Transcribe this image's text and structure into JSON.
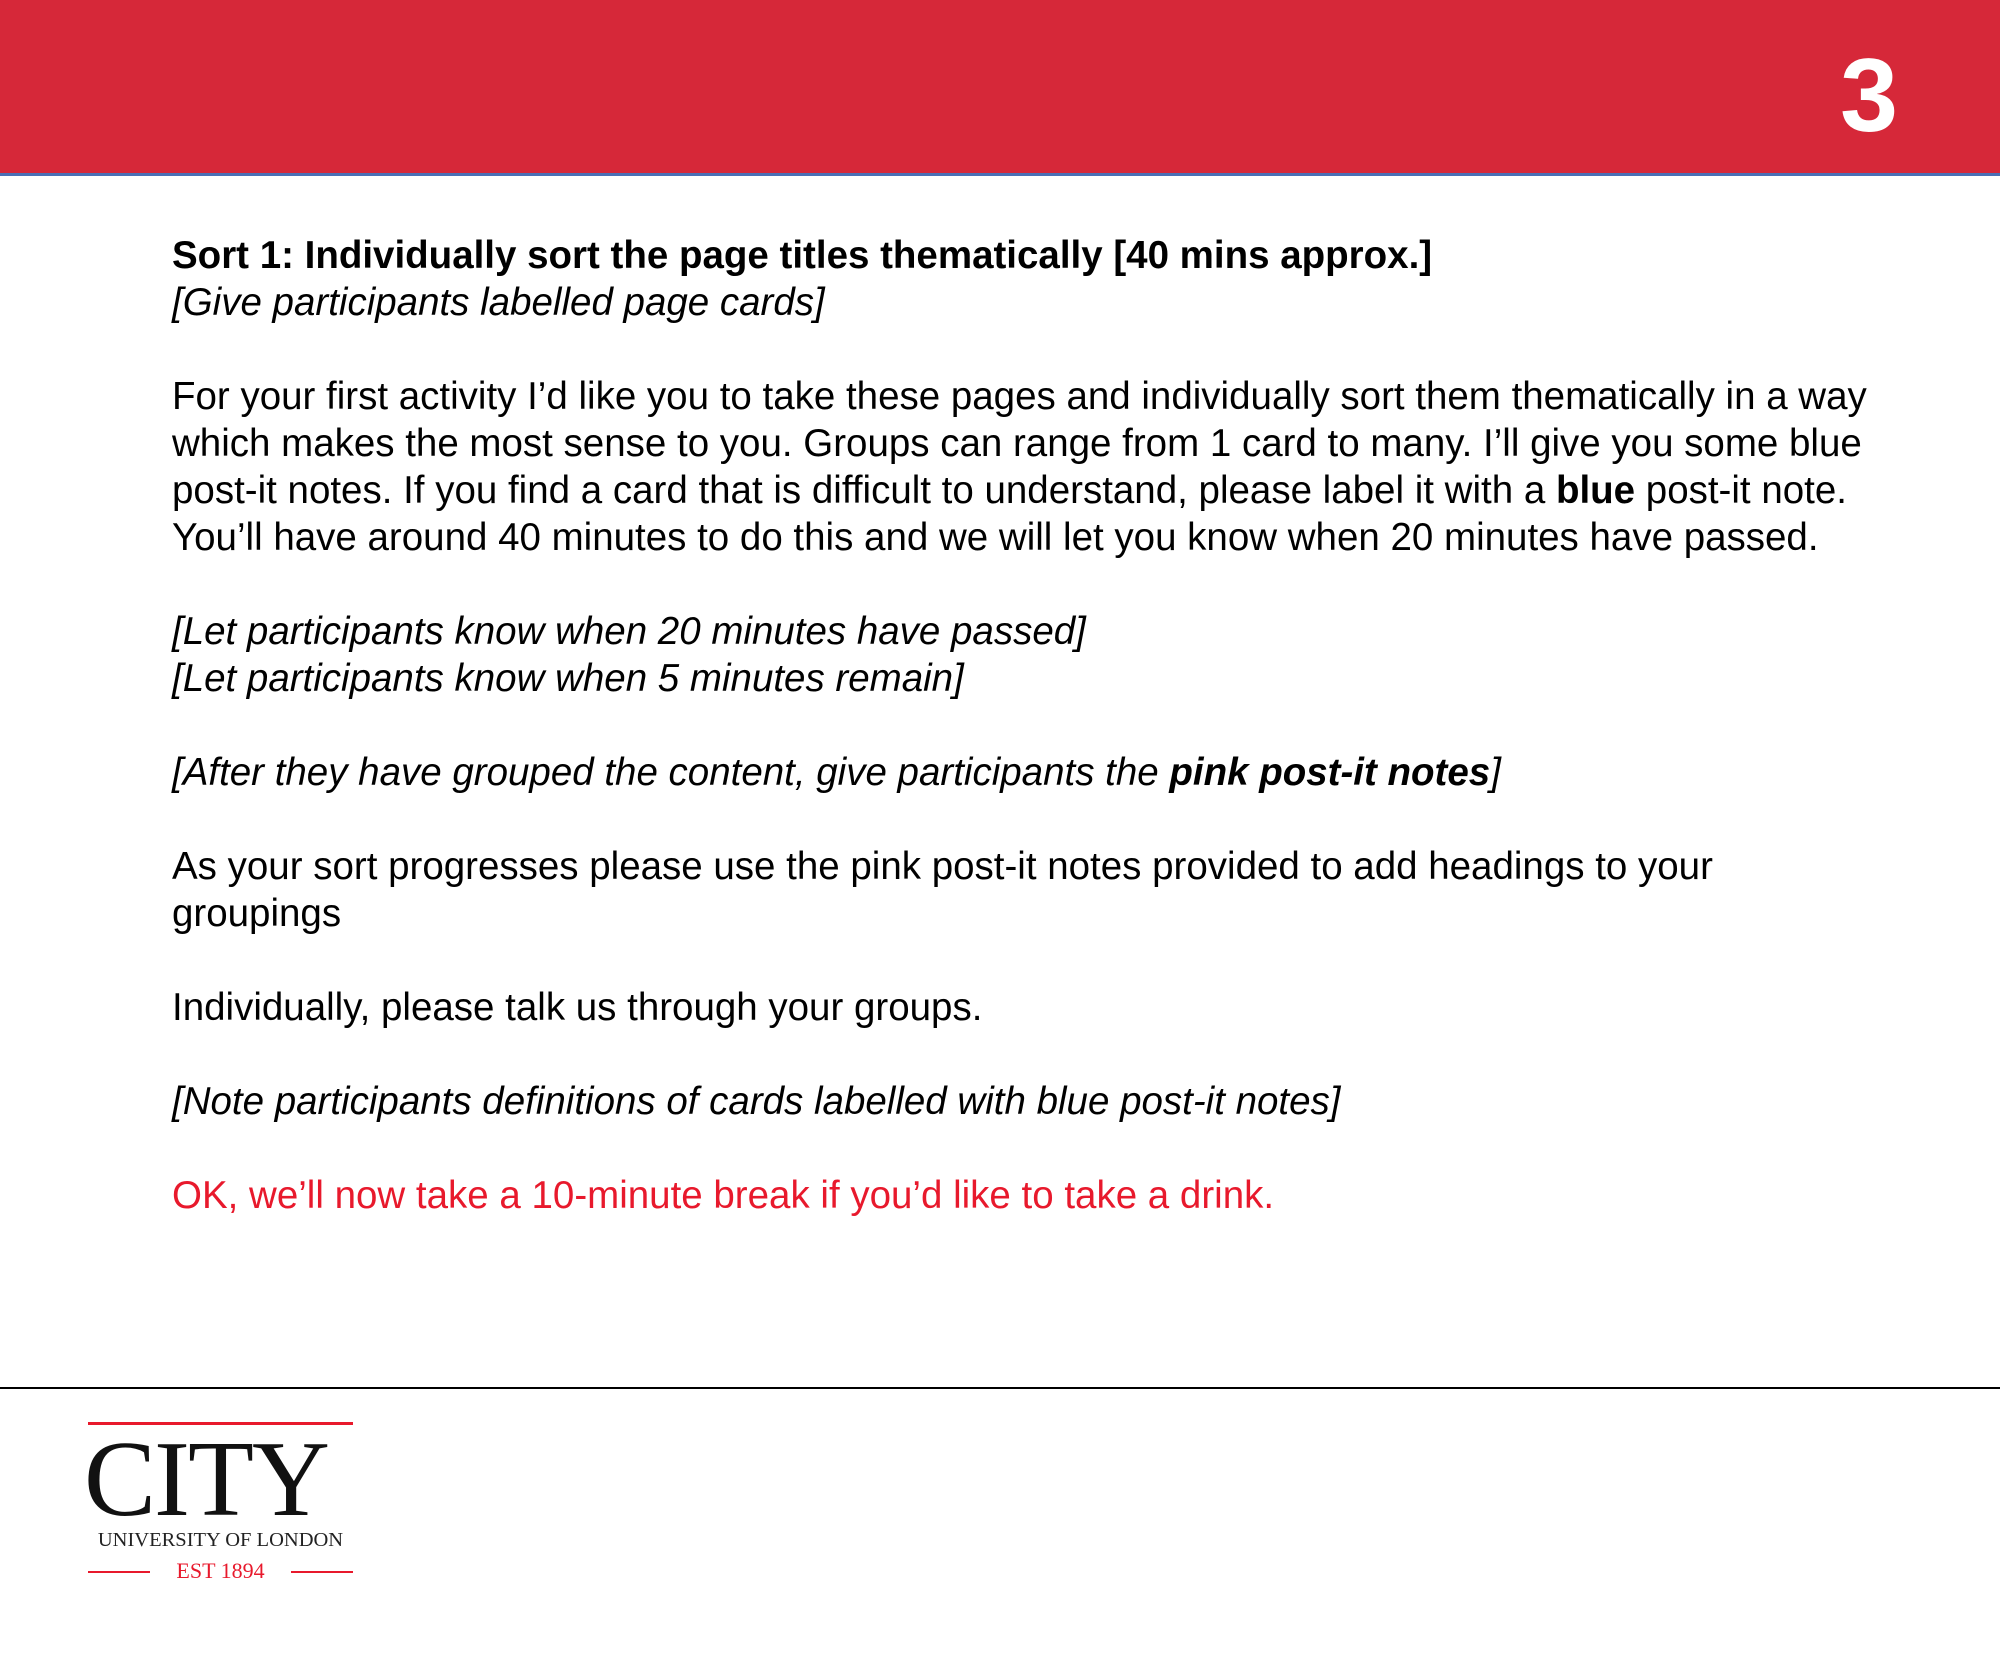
{
  "colors": {
    "header_red": "#d62839",
    "accent_red": "#e8192c",
    "header_underline_blue": "#4a6fb5"
  },
  "header": {
    "page_number": "3"
  },
  "content": {
    "heading": "Sort 1: Individually sort the page titles thematically [40 mins approx.]",
    "give_cards_instruction": "[Give participants labelled page cards]",
    "paragraph1": {
      "before_bold": "For your first activity I’d like you to take these pages and individually sort them thematically in a way which makes the most sense to you. Groups can range from 1 card to many. I’ll give you some blue post-it notes. If you find a card that is difficult to understand, please label it with a ",
      "bold": "blue",
      "after_bold": " post-it note. You’ll have around 40 minutes to do this and we will let you know when 20 minutes have passed."
    },
    "instruction_20_minutes": "[Let participants know when 20 minutes have passed]",
    "instruction_5_minutes": "[Let participants know when 5 minutes remain]",
    "pink_instruction": {
      "before_bold": "[After they have grouped the content, give participants the ",
      "bold": "pink post-it notes",
      "after_bold": "]"
    },
    "headings_paragraph": "As your sort progresses please use the pink post-it notes provided to add headings to your groupings",
    "talk_through": "Individually, please talk us through your groups.",
    "note_instruction": "[Note participants definitions of cards labelled with blue post-it notes]",
    "break_line": "OK, we’ll now take a 10-minute break if you’d like to take a drink."
  },
  "logo": {
    "word": "CITY",
    "subtitle": "UNIVERSITY OF LONDON",
    "established": "EST 1894"
  }
}
